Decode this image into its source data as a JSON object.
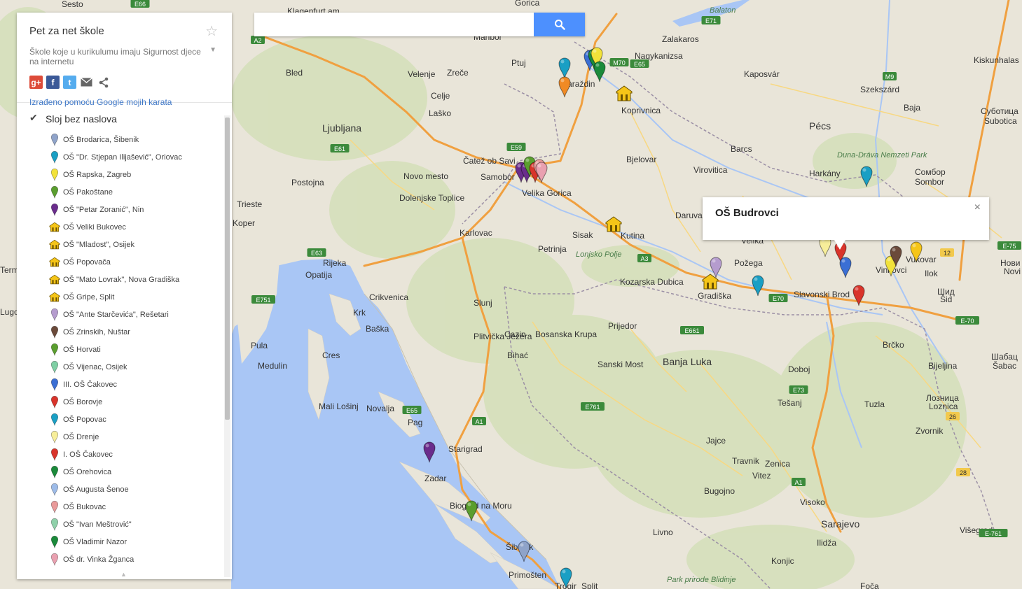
{
  "panel": {
    "title": "Pet za net škole",
    "description": "Škole koje u kurikulumu imaju Sigurnost djece na internetu",
    "made_with": "Izrađeno pomoću Google mojih karata",
    "layer_title": "Sloj bez naslova",
    "share_icons": [
      "google-plus-icon",
      "facebook-icon",
      "twitter-icon",
      "email-icon",
      "share-icon"
    ],
    "items": [
      {
        "label": "OŠ Brodarica, Šibenik",
        "color": "#8fa3c9",
        "icon": "pin"
      },
      {
        "label": "OŠ \"Dr. Stjepan Ilijašević\", Oriovac",
        "color": "#1a9fc4",
        "icon": "pin"
      },
      {
        "label": "OŠ Rapska, Zagreb",
        "color": "#f2e23a",
        "icon": "pin"
      },
      {
        "label": "OŠ Pakoštane",
        "color": "#5a9e2e",
        "icon": "pin"
      },
      {
        "label": "OŠ \"Petar Zoranić\", Nin",
        "color": "#6a2c8c",
        "icon": "pin"
      },
      {
        "label": "OŠ Veliki Bukovec",
        "color": "#f5c518",
        "icon": "school"
      },
      {
        "label": "OŠ \"Mladost\", Osijek",
        "color": "#f5c518",
        "icon": "school"
      },
      {
        "label": "OŠ Popovača",
        "color": "#f5c518",
        "icon": "school"
      },
      {
        "label": "OŠ \"Mato Lovrak\", Nova Gradiška",
        "color": "#f5c518",
        "icon": "school"
      },
      {
        "label": "OŠ Gripe, Split",
        "color": "#f5c518",
        "icon": "school"
      },
      {
        "label": "OŠ \"Ante Starčevića\", Rešetari",
        "color": "#b59cce",
        "icon": "pin"
      },
      {
        "label": "OŠ Zrinskih, Nuštar",
        "color": "#6b4a3a",
        "icon": "pin"
      },
      {
        "label": "OŠ Horvati",
        "color": "#5a9e2e",
        "icon": "pin"
      },
      {
        "label": "OŠ Vijenac, Osijek",
        "color": "#7fcfa4",
        "icon": "pin"
      },
      {
        "label": "III. OŠ Čakovec",
        "color": "#3b6fd4",
        "icon": "pin"
      },
      {
        "label": "OŠ Borovje",
        "color": "#d9342b",
        "icon": "pin"
      },
      {
        "label": "OŠ Popovac",
        "color": "#1a9fc4",
        "icon": "pin"
      },
      {
        "label": "OŠ Drenje",
        "color": "#f7ee9a",
        "icon": "pin"
      },
      {
        "label": "I. OŠ Čakovec",
        "color": "#d9342b",
        "icon": "pin"
      },
      {
        "label": "OŠ Orehovica",
        "color": "#1a8a3a",
        "icon": "pin"
      },
      {
        "label": "OŠ Augusta Šenoe",
        "color": "#9dbbe8",
        "icon": "pin"
      },
      {
        "label": "OŠ Bukovac",
        "color": "#e99a9a",
        "icon": "pin"
      },
      {
        "label": "OŠ \"Ivan Meštrović\"",
        "color": "#8fd1aa",
        "icon": "pin"
      },
      {
        "label": "OŠ Vladimir Nazor",
        "color": "#1a8a3a",
        "icon": "pin"
      },
      {
        "label": "OŠ dr. Vinka Žganca",
        "color": "#e9a0b0",
        "icon": "pin"
      }
    ]
  },
  "search": {
    "placeholder": ""
  },
  "info_window": {
    "title": "OŠ Budrovci",
    "close": "×"
  },
  "map_labels": [
    "Klagenfurt am",
    "Maribor",
    "Ptuj",
    "Varaždin",
    "Nagykanizsa",
    "Kaposvár",
    "Balaton",
    "Zalakaros",
    "Pécs",
    "Szekszárd",
    "Baja",
    "Kiskunhalas",
    "Velenje",
    "Celje",
    "Laško",
    "Ljubljana",
    "Bled",
    "Zreče",
    "Koprivnica",
    "Bjelovar",
    "Virovitica",
    "Barcs",
    "Harkány",
    "Duna-Dráva Nemzeti Park",
    "Subotica",
    "Суботица",
    "Sombor",
    "Сомбор",
    "Čatež ob Savi",
    "Samobor",
    "Novo mesto",
    "Dolenjske Toplice",
    "Postojna",
    "Velika Gorica",
    "Trieste",
    "Koper",
    "Karlovac",
    "Kutina",
    "Sisak",
    "Lonjsko Polje",
    "Daruvar",
    "Petrinja",
    "Rijeka",
    "Opatija",
    "Crikvenica",
    "Krk",
    "Baška",
    "Pula",
    "Medulin",
    "Cres",
    "Mali Lošinj",
    "Novalja",
    "Pag",
    "Slunj",
    "Plitvička Jezera",
    "Cazin",
    "Bihać",
    "Bosanska Krupa",
    "Prijedor",
    "Sanski Most",
    "Banja Luka",
    "Kozarska Dubica",
    "Gradiška",
    "Požega",
    "Slavonski Brod",
    "Vinkovci",
    "Vukovar",
    "Šid",
    "Шид",
    "Brčko",
    "Bijeljina",
    "Doboj",
    "Tešanj",
    "Tuzla",
    "Zenica",
    "Jajce",
    "Travnik",
    "Vitez",
    "Bugojno",
    "Visoko",
    "Sarajevo",
    "Ilidža",
    "Višegrad",
    "Konjic",
    "Livno",
    "Zadar",
    "Starigrad",
    "Biograd na Moru",
    "Šibenik",
    "Primošten",
    "Trogir",
    "Split",
    "Zvornik",
    "Лозница",
    "Loznica",
    "Šabac",
    "Шабац",
    "Нови Сад",
    "Novi Sad",
    "Velika",
    "Ilok",
    "Park prirode Blidinje",
    "Foča",
    "Sesto",
    "Termoli",
    "Lugo",
    "Gorica"
  ],
  "road_labels": [
    "E66",
    "E71",
    "M70",
    "E65",
    "M9",
    "E59",
    "E61",
    "A2",
    "E63",
    "E751",
    "E70",
    "A3",
    "E661",
    "E73",
    "E761",
    "A1",
    "E-70",
    "E-75",
    "E-761",
    "12",
    "26",
    "28",
    "E65",
    "A1"
  ]
}
